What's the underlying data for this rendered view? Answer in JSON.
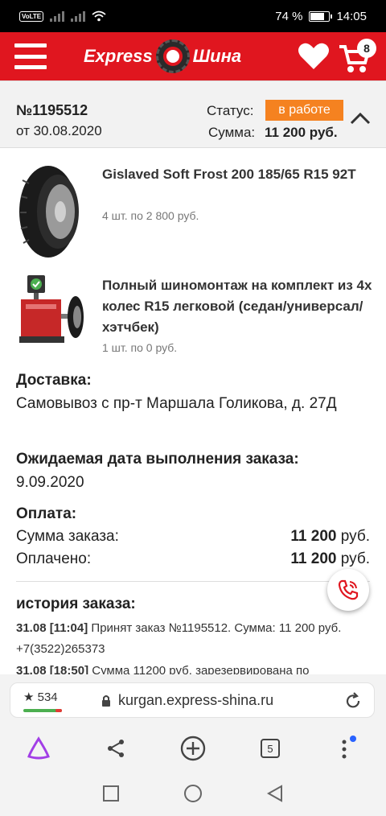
{
  "status_bar": {
    "volte": "VoLTE",
    "battery": "74 %",
    "battery_level": 0.74,
    "time": "14:05"
  },
  "header": {
    "logo_left": "Express",
    "logo_right": "Шина",
    "cart_count": "8",
    "brand_color": "#e0161f"
  },
  "order": {
    "number": "№1195512",
    "date": "от 30.08.2020",
    "status_label": "Статус:",
    "status_value": "в работе",
    "sum_label": "Сумма:",
    "sum_value": "11 200 руб.",
    "status_color": "#f58220"
  },
  "items": [
    {
      "title": "Gislaved Soft Frost 200 185/65 R15 92T",
      "sub": "4 шт. по 2 800 руб.",
      "icon": "tire-icon"
    },
    {
      "title": "Полный шиномонтаж на комплект из 4х колес R15 легковой (седан/универсал/хэтчбек)",
      "sub": "1 шт. по 0 руб.",
      "icon": "tire-machine-icon"
    }
  ],
  "delivery": {
    "title": "Доставка:",
    "text": "Самовывоз с пр-т Маршала Голикова, д. 27Д"
  },
  "expected": {
    "title": "Ожидаемая дата выполнения заказа:",
    "text": "9.09.2020"
  },
  "payment": {
    "title": "Оплата:",
    "order_sum_label": "Сумма заказа:",
    "order_sum_num": "11 200",
    "paid_label": "Оплачено:",
    "paid_num": "11 200",
    "currency": "руб."
  },
  "history": {
    "title": "история заказа:",
    "entries": [
      {
        "time": "31.08 [11:04]",
        "text": "Принят заказ №1195512. Сумма: 11 200 руб. +7(3522)265373"
      },
      {
        "time": "31.08 [18:50]",
        "text": "Сумма 11200 руб. зарезервирована по"
      }
    ]
  },
  "browser": {
    "rating": "★ 534",
    "url": "kurgan.express-shina.ru",
    "tabs": "5"
  }
}
